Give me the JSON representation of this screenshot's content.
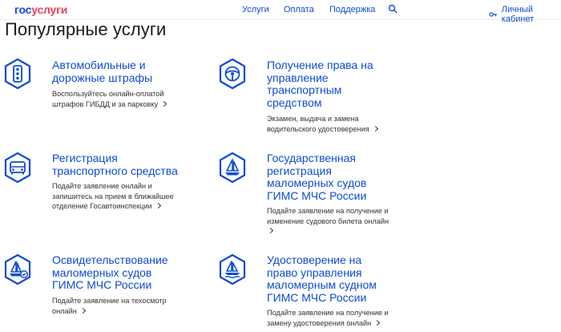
{
  "header": {
    "logo_gos": "гос",
    "logo_uslugi": "услуги",
    "nav": [
      "Услуги",
      "Оплата",
      "Поддержка"
    ],
    "cabinet_label": "Личный кабинет"
  },
  "page_title": "Популярные услуги",
  "cards": [
    {
      "title_lines": [
        "Автомобильные и",
        "дорожные штрафы"
      ],
      "desc_lines": [
        "Воспользуйтесь онлайн-оплатой",
        "штрафов ГИБДД и за парковку"
      ],
      "icon": "traffic-light-icon"
    },
    {
      "title_lines": [
        "Получение права на",
        "управление",
        "транспортным",
        "средством"
      ],
      "desc_lines": [
        "Экзамен, выдача и замена",
        "водительского удостоверения"
      ],
      "icon": "steering-wheel-icon"
    },
    {
      "title_lines": [
        "Регистрация",
        "транспортного средства"
      ],
      "desc_lines": [
        "Подайте заявление онлайн и",
        "запишитесь на прием в ближайшее",
        "отделение Госавтоинспекции"
      ],
      "icon": "car-front-icon"
    },
    {
      "title_lines": [
        "Государственная",
        "регистрация",
        "маломерных судов",
        "ГИМС МЧС России"
      ],
      "desc_lines": [
        "Подайте заявление на получение и",
        "изменение судового билета онлайн"
      ],
      "icon": "sailboat-icon"
    },
    {
      "title_lines": [
        "Освидетельствование",
        "маломерных судов",
        "ГИМС МЧС России"
      ],
      "desc_lines": [
        "Подайте заявление на техосмотр",
        "онлайн"
      ],
      "icon": "boat-check-icon"
    },
    {
      "title_lines": [
        "Удостоверение на",
        "право управления",
        "маломерным судном",
        "ГИМС МЧС России"
      ],
      "desc_lines": [
        "Подайте заявление на получение и",
        "замену удостоверения онлайн"
      ],
      "icon": "sailboat-license-icon"
    }
  ],
  "colors": {
    "accent": "#0d4cd3",
    "logo_red": "#ee3f58",
    "icon_ring": "#0d4cd3"
  }
}
